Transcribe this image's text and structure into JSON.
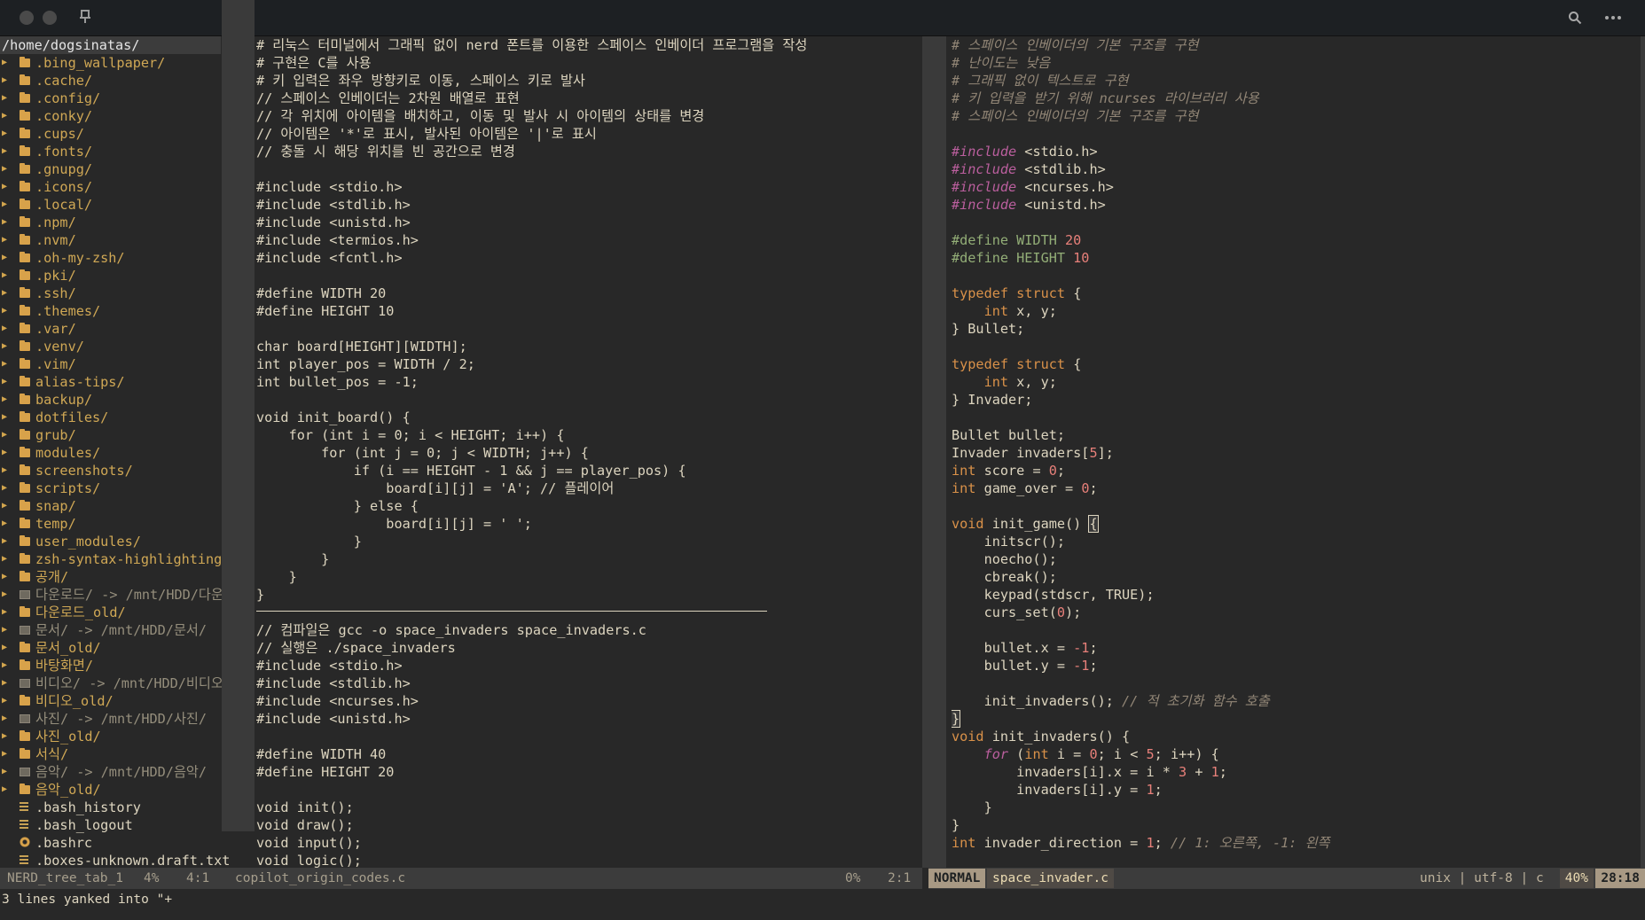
{
  "tree": {
    "path": "/home/dogsinatas/",
    "items": [
      {
        "name": ".bing_wallpaper/",
        "kind": "dir"
      },
      {
        "name": ".cache/",
        "kind": "dir"
      },
      {
        "name": ".config/",
        "kind": "dir"
      },
      {
        "name": ".conky/",
        "kind": "dir"
      },
      {
        "name": ".cups/",
        "kind": "dir"
      },
      {
        "name": ".fonts/",
        "kind": "dir"
      },
      {
        "name": ".gnupg/",
        "kind": "dir"
      },
      {
        "name": ".icons/",
        "kind": "dir"
      },
      {
        "name": ".local/",
        "kind": "dir"
      },
      {
        "name": ".npm/",
        "kind": "dir"
      },
      {
        "name": ".nvm/",
        "kind": "dir"
      },
      {
        "name": ".oh-my-zsh/",
        "kind": "dir"
      },
      {
        "name": ".pki/",
        "kind": "dir"
      },
      {
        "name": ".ssh/",
        "kind": "dir"
      },
      {
        "name": ".themes/",
        "kind": "dir"
      },
      {
        "name": ".var/",
        "kind": "dir"
      },
      {
        "name": ".venv/",
        "kind": "dir"
      },
      {
        "name": ".vim/",
        "kind": "dir"
      },
      {
        "name": "alias-tips/",
        "kind": "dir"
      },
      {
        "name": "backup/",
        "kind": "dir"
      },
      {
        "name": "dotfiles/",
        "kind": "dir"
      },
      {
        "name": "grub/",
        "kind": "dir"
      },
      {
        "name": "modules/",
        "kind": "dir"
      },
      {
        "name": "screenshots/",
        "kind": "dir"
      },
      {
        "name": "scripts/",
        "kind": "dir"
      },
      {
        "name": "snap/",
        "kind": "dir"
      },
      {
        "name": "temp/",
        "kind": "dir"
      },
      {
        "name": "user_modules/",
        "kind": "dir"
      },
      {
        "name": "zsh-syntax-highlighting/",
        "kind": "dir"
      },
      {
        "name": "공개/",
        "kind": "dir"
      },
      {
        "name": "다운로드/ -> /mnt/HDD/다운",
        "kind": "link"
      },
      {
        "name": "다운로드_old/",
        "kind": "dir"
      },
      {
        "name": "문서/ -> /mnt/HDD/문서/",
        "kind": "link"
      },
      {
        "name": "문서_old/",
        "kind": "dir"
      },
      {
        "name": "바탕화면/",
        "kind": "dir"
      },
      {
        "name": "비디오/ -> /mnt/HDD/비디오",
        "kind": "link"
      },
      {
        "name": "비디오_old/",
        "kind": "dir"
      },
      {
        "name": "사진/ -> /mnt/HDD/사진/",
        "kind": "link"
      },
      {
        "name": "사진_old/",
        "kind": "dir"
      },
      {
        "name": "서식/",
        "kind": "dir"
      },
      {
        "name": "음악/ -> /mnt/HDD/음악/",
        "kind": "link"
      },
      {
        "name": "음악_old/",
        "kind": "dir"
      },
      {
        "name": ".bash_history",
        "kind": "file"
      },
      {
        "name": ".bash_logout",
        "kind": "file"
      },
      {
        "name": ".bashrc",
        "kind": "config"
      },
      {
        "name": ".boxes-unknown.draft.txt",
        "kind": "file"
      }
    ]
  },
  "left_code": [
    "# 리눅스 터미널에서 그래픽 없이 nerd 폰트를 이용한 스페이스 인베이더 프로그램을 작성",
    "# 구현은 C를 사용",
    "# 키 입력은 좌우 방향키로 이동, 스페이스 키로 발사",
    "// 스페이스 인베이더는 2차원 배열로 표현",
    "// 각 위치에 아이템을 배치하고, 이동 및 발사 시 아이템의 상태를 변경",
    "// 아이템은 '*'로 표시, 발사된 아이템은 '|'로 표시",
    "// 충돌 시 해당 위치를 빈 공간으로 변경",
    "",
    "#include <stdio.h>",
    "#include <stdlib.h>",
    "#include <unistd.h>",
    "#include <termios.h>",
    "#include <fcntl.h>",
    "",
    "#define WIDTH 20",
    "#define HEIGHT 10",
    "",
    "char board[HEIGHT][WIDTH];",
    "int player_pos = WIDTH / 2;",
    "int bullet_pos = -1;",
    "",
    "void init_board() {",
    "    for (int i = 0; i < HEIGHT; i++) {",
    "        for (int j = 0; j < WIDTH; j++) {",
    "            if (i == HEIGHT - 1 && j == player_pos) {",
    "                board[i][j] = 'A'; // 플레이어",
    "            } else {",
    "                board[i][j] = ' ';",
    "            }",
    "        }",
    "    }",
    "}",
    "",
    "// 컴파일은 gcc -o space_invaders space_invaders.c",
    "// 실행은 ./space_invaders",
    "#include <stdio.h>",
    "#include <stdlib.h>",
    "#include <ncurses.h>",
    "#include <unistd.h>",
    "",
    "#define WIDTH 40",
    "#define HEIGHT 20",
    "",
    "void init();",
    "void draw();",
    "void input();",
    "void logic();"
  ],
  "right_code": [
    [
      [
        "cm",
        "# 스페이스 인베이더의 기본 구조를 구현"
      ]
    ],
    [
      [
        "cm",
        "# 난이도는 낮음"
      ]
    ],
    [
      [
        "cm",
        "# 그래픽 없이 텍스트로 구현"
      ]
    ],
    [
      [
        "cm",
        "# 키 입력을 받기 위해 ncurses 라이브러리 사용"
      ]
    ],
    [
      [
        "cm",
        "# 스페이스 인베이더의 기본 구조를 구현"
      ]
    ],
    [],
    [
      [
        "pp",
        "#include"
      ],
      [
        "",
        " <stdio.h>"
      ]
    ],
    [
      [
        "pp",
        "#include"
      ],
      [
        "",
        " <stdlib.h>"
      ]
    ],
    [
      [
        "pp",
        "#include"
      ],
      [
        "",
        " <ncurses.h>"
      ]
    ],
    [
      [
        "pp",
        "#include"
      ],
      [
        "",
        " <unistd.h>"
      ]
    ],
    [],
    [
      [
        "mac",
        "#define WIDTH "
      ],
      [
        "num",
        "20"
      ]
    ],
    [
      [
        "mac",
        "#define HEIGHT "
      ],
      [
        "num",
        "10"
      ]
    ],
    [],
    [
      [
        "ty",
        "typedef"
      ],
      [
        "",
        " "
      ],
      [
        "ty",
        "struct"
      ],
      [
        "",
        " {"
      ]
    ],
    [
      [
        "",
        "    "
      ],
      [
        "ty",
        "int"
      ],
      [
        "",
        " x, y;"
      ]
    ],
    [
      [
        "",
        "} Bullet;"
      ]
    ],
    [],
    [
      [
        "ty",
        "typedef"
      ],
      [
        "",
        " "
      ],
      [
        "ty",
        "struct"
      ],
      [
        "",
        " {"
      ]
    ],
    [
      [
        "",
        "    "
      ],
      [
        "ty",
        "int"
      ],
      [
        "",
        " x, y;"
      ]
    ],
    [
      [
        "",
        "} Invader;"
      ]
    ],
    [],
    [
      [
        "",
        "Bullet bullet;"
      ]
    ],
    [
      [
        "",
        "Invader invaders["
      ],
      [
        "num",
        "5"
      ],
      [
        "",
        "];"
      ]
    ],
    [
      [
        "ty",
        "int"
      ],
      [
        "",
        " score = "
      ],
      [
        "num",
        "0"
      ],
      [
        "",
        ";"
      ]
    ],
    [
      [
        "ty",
        "int"
      ],
      [
        "",
        " game_over = "
      ],
      [
        "num",
        "0"
      ],
      [
        "",
        ";"
      ]
    ],
    [],
    [
      [
        "ty",
        "void"
      ],
      [
        "",
        " init_game() "
      ],
      [
        "cursor",
        "{"
      ]
    ],
    [
      [
        "",
        "    initscr();"
      ]
    ],
    [
      [
        "",
        "    noecho();"
      ]
    ],
    [
      [
        "",
        "    cbreak();"
      ]
    ],
    [
      [
        "",
        "    keypad(stdscr, TRUE);"
      ]
    ],
    [
      [
        "",
        "    curs_set("
      ],
      [
        "num",
        "0"
      ],
      [
        "",
        ");"
      ]
    ],
    [],
    [
      [
        "",
        "    bullet.x = "
      ],
      [
        "num",
        "-1"
      ],
      [
        "",
        ";"
      ]
    ],
    [
      [
        "",
        "    bullet.y = "
      ],
      [
        "num",
        "-1"
      ],
      [
        "",
        ";"
      ]
    ],
    [],
    [
      [
        "",
        "    init_invaders(); "
      ],
      [
        "cm",
        "// 적 초기화 함수 호출"
      ]
    ],
    [
      [
        "cursor",
        "}"
      ]
    ],
    [
      [
        "ty",
        "void"
      ],
      [
        "",
        " init_invaders() {"
      ]
    ],
    [
      [
        "",
        "    "
      ],
      [
        "pp",
        "for"
      ],
      [
        "",
        " ("
      ],
      [
        "ty",
        "int"
      ],
      [
        "",
        " i = "
      ],
      [
        "num",
        "0"
      ],
      [
        "",
        "; i < "
      ],
      [
        "num",
        "5"
      ],
      [
        "",
        "; i++) {"
      ]
    ],
    [
      [
        "",
        "        invaders[i].x = i * "
      ],
      [
        "num",
        "3"
      ],
      [
        "",
        " + "
      ],
      [
        "num",
        "1"
      ],
      [
        "",
        ";"
      ]
    ],
    [
      [
        "",
        "        invaders[i].y = "
      ],
      [
        "num",
        "1"
      ],
      [
        "",
        ";"
      ]
    ],
    [
      [
        "",
        "    }"
      ]
    ],
    [
      [
        "",
        "}"
      ]
    ],
    [
      [
        "ty",
        "int"
      ],
      [
        "",
        " invader_direction = "
      ],
      [
        "num",
        "1"
      ],
      [
        "",
        "; "
      ],
      [
        "cm",
        "// 1: 오른쪽, -1: 왼쪽"
      ]
    ]
  ],
  "status": {
    "tree_name": "NERD_tree_tab_1",
    "tree_pct": "4%",
    "tree_pos": "4:1",
    "left_file": "copilot_origin_codes.c",
    "left_pct": "0%",
    "left_pos": "2:1",
    "mode": "NORMAL",
    "right_file": "space_invader.c",
    "right_info": "unix | utf-8 | c",
    "right_pct": "40%",
    "right_pos": "28:18"
  },
  "message": "3 lines yanked into \"+",
  "colors": {
    "background": "#282828",
    "folder": "#d8a24a",
    "keyword": "#d99149",
    "preproc": "#bb5f9e",
    "macro": "#93ae77",
    "number": "#e8807a",
    "comment": "#928676"
  }
}
